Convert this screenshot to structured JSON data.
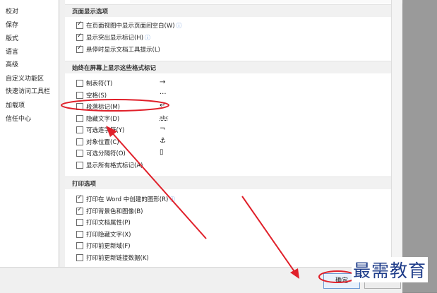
{
  "sidebar": {
    "items": [
      {
        "label": "校对"
      },
      {
        "label": "保存"
      },
      {
        "label": "版式"
      },
      {
        "label": "语言"
      },
      {
        "label": "高级"
      },
      {
        "label": "自定义功能区"
      },
      {
        "label": "快速访问工具栏"
      },
      {
        "label": "加载项"
      },
      {
        "label": "信任中心"
      }
    ]
  },
  "page_display": {
    "title": "页面显示选项",
    "options": [
      {
        "label": "在页面视图中显示页面间空白(W)",
        "checked": true,
        "info": true
      },
      {
        "label": "显示突出显示标记(H)",
        "checked": true,
        "info": true
      },
      {
        "label": "悬停时显示文档工具提示(L)",
        "checked": true,
        "info": false
      }
    ]
  },
  "formatting_marks": {
    "title": "始终在屏幕上显示这些格式标记",
    "options": [
      {
        "label": "制表符(T)",
        "checked": false,
        "glyph": "→"
      },
      {
        "label": "空格(S)",
        "checked": false,
        "glyph": "···"
      },
      {
        "label": "段落标记(M)",
        "checked": false,
        "glyph": "↵"
      },
      {
        "label": "隐藏文字(D)",
        "checked": false,
        "glyph": "abc"
      },
      {
        "label": "可选连字符(Y)",
        "checked": false,
        "glyph": "¬"
      },
      {
        "label": "对象位置(C)",
        "checked": false,
        "glyph": "⚓"
      },
      {
        "label": "可选分隔符(O)",
        "checked": false,
        "glyph": "▯"
      },
      {
        "label": "显示所有格式标记(A)",
        "checked": false,
        "glyph": ""
      }
    ]
  },
  "print_options": {
    "title": "打印选项",
    "options": [
      {
        "label": "打印在 Word 中创建的图形(R)",
        "checked": true,
        "info": true
      },
      {
        "label": "打印背景色和图像(B)",
        "checked": true,
        "info": false
      },
      {
        "label": "打印文档属性(P)",
        "checked": false,
        "info": false
      },
      {
        "label": "打印隐藏文字(X)",
        "checked": false,
        "info": false
      },
      {
        "label": "打印前更新域(F)",
        "checked": false,
        "info": false
      },
      {
        "label": "打印前更新链接数据(K)",
        "checked": false,
        "info": false
      }
    ]
  },
  "footer": {
    "ok_label": "确定",
    "cancel_label": ""
  },
  "watermark": {
    "text": "最需教育"
  },
  "colors": {
    "annotation_red": "#e0202a",
    "watermark_blue": "#1f3d8a",
    "ok_border": "#6b99d3"
  },
  "icons": {
    "info": "info-icon",
    "checkbox": "checkbox-icon"
  }
}
